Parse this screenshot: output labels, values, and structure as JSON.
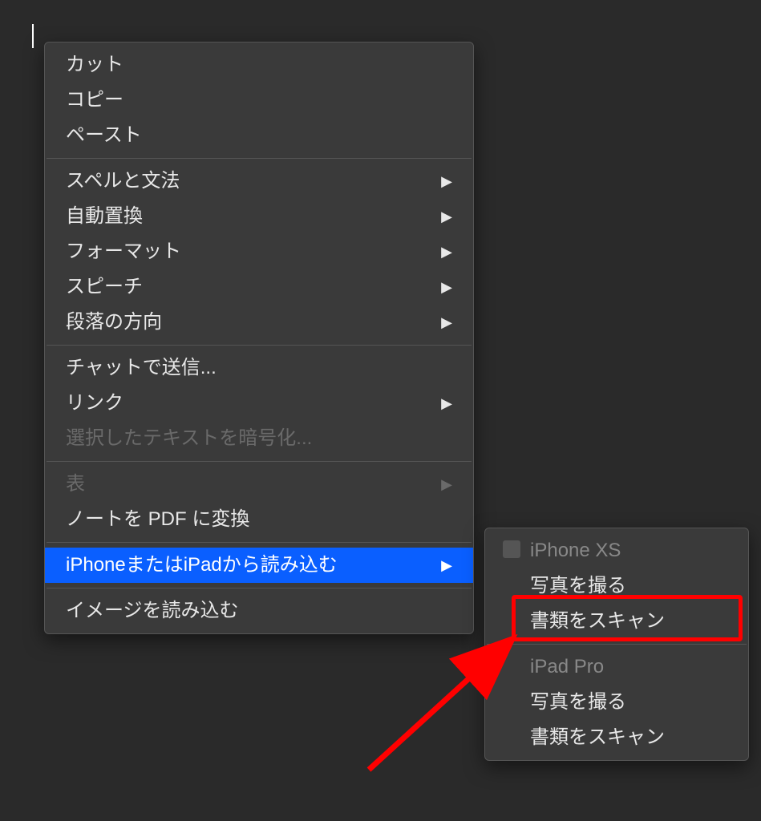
{
  "main_menu": {
    "group1": [
      {
        "label": "カット",
        "name": "cut"
      },
      {
        "label": "コピー",
        "name": "copy"
      },
      {
        "label": "ペースト",
        "name": "paste"
      }
    ],
    "group2": [
      {
        "label": "スペルと文法",
        "name": "spelling-grammar",
        "arrow": true
      },
      {
        "label": "自動置換",
        "name": "substitutions",
        "arrow": true
      },
      {
        "label": "フォーマット",
        "name": "format",
        "arrow": true
      },
      {
        "label": "スピーチ",
        "name": "speech",
        "arrow": true
      },
      {
        "label": "段落の方向",
        "name": "paragraph-direction",
        "arrow": true
      }
    ],
    "group3": [
      {
        "label": "チャットで送信...",
        "name": "send-in-chat"
      },
      {
        "label": "リンク",
        "name": "link",
        "arrow": true
      },
      {
        "label": "選択したテキストを暗号化...",
        "name": "encrypt-text",
        "disabled": true
      }
    ],
    "group4": [
      {
        "label": "表",
        "name": "table",
        "arrow": true,
        "disabled": true
      },
      {
        "label": "ノートを PDF に変換",
        "name": "convert-to-pdf"
      }
    ],
    "group5": [
      {
        "label": "iPhoneまたはiPadから読み込む",
        "name": "import-from-iphone-ipad",
        "arrow": true,
        "highlighted": true
      }
    ],
    "group6": [
      {
        "label": "イメージを読み込む",
        "name": "import-image"
      }
    ]
  },
  "submenu": {
    "device1": {
      "name": "iPhone XS",
      "items": [
        {
          "label": "写真を撮る",
          "name": "take-photo-iphone"
        },
        {
          "label": "書類をスキャン",
          "name": "scan-documents-iphone"
        }
      ]
    },
    "device2": {
      "name": "iPad Pro",
      "items": [
        {
          "label": "写真を撮る",
          "name": "take-photo-ipad"
        },
        {
          "label": "書類をスキャン",
          "name": "scan-documents-ipad"
        }
      ]
    }
  },
  "arrow_glyph": "▶"
}
